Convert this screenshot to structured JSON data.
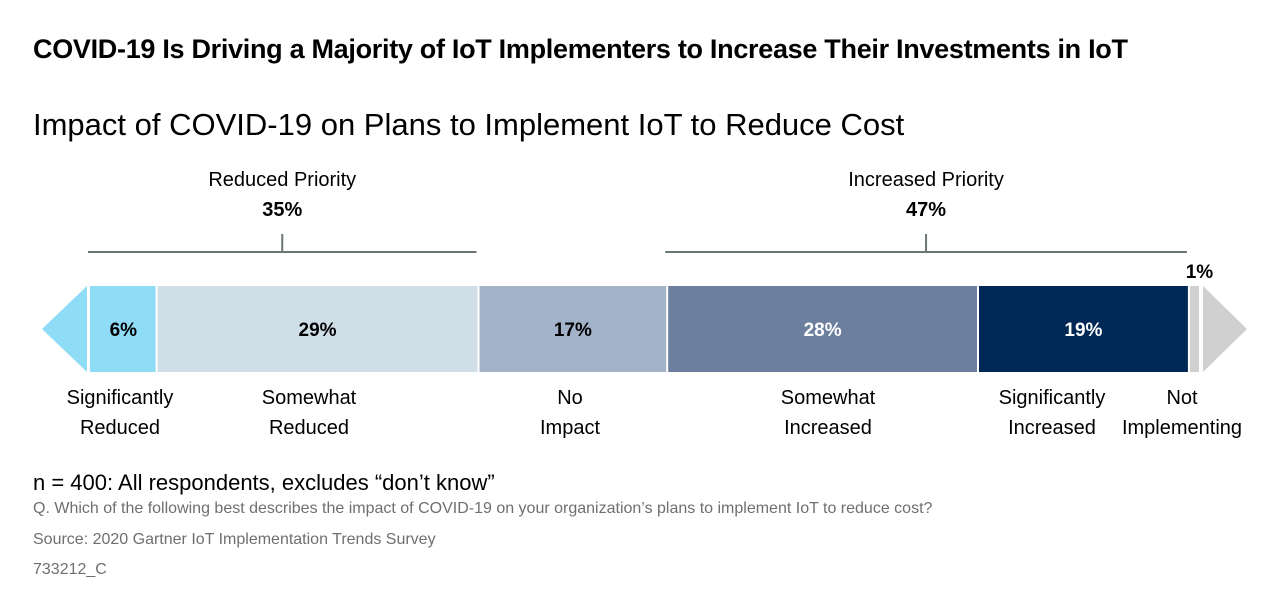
{
  "chart_data": {
    "type": "bar",
    "orientation": "horizontal-stacked",
    "title": "COVID-19 Is Driving a Majority of IoT Implementers to Increase Their Investments in IoT",
    "subtitle": "Impact of COVID-19 on Plans to Implement IoT to Reduce Cost",
    "categories": [
      "Significantly Reduced",
      "Somewhat Reduced",
      "No Impact",
      "Somewhat Increased",
      "Significantly Increased",
      "Not Implementing"
    ],
    "category_lines": [
      [
        "Significantly",
        "Reduced"
      ],
      [
        "Somewhat",
        "Reduced"
      ],
      [
        "No",
        "Impact"
      ],
      [
        "Somewhat",
        "Increased"
      ],
      [
        "Significantly",
        "Increased"
      ],
      [
        "Not",
        "Implementing"
      ]
    ],
    "values": [
      6,
      29,
      17,
      28,
      19,
      1
    ],
    "value_labels": [
      "6%",
      "29%",
      "17%",
      "28%",
      "19%",
      "1%"
    ],
    "colors": [
      "#8fdcf7",
      "#d0dee8",
      "#a2b3c9",
      "#6c7f9f",
      "#002856",
      "#d0d0d0"
    ],
    "label_colors": [
      "#000000",
      "#000000",
      "#000000",
      "#ffffff",
      "#ffffff",
      "#000000"
    ],
    "groups": [
      {
        "label": "Reduced Priority",
        "value_label": "35%",
        "value": 35,
        "members": [
          0,
          1
        ]
      },
      {
        "label": "Increased Priority",
        "value_label": "47%",
        "value": 47,
        "members": [
          3,
          4
        ]
      }
    ],
    "xlim": [
      0,
      100
    ]
  },
  "notes": {
    "n": "n = 400: All respondents, excludes “don’t know”",
    "question": "Q. Which of the following best describes the impact of COVID-19 on your organization’s plans to implement IoT to reduce cost?",
    "source": "Source: 2020 Gartner IoT Implementation Trends Survey",
    "id": "733212_C"
  }
}
